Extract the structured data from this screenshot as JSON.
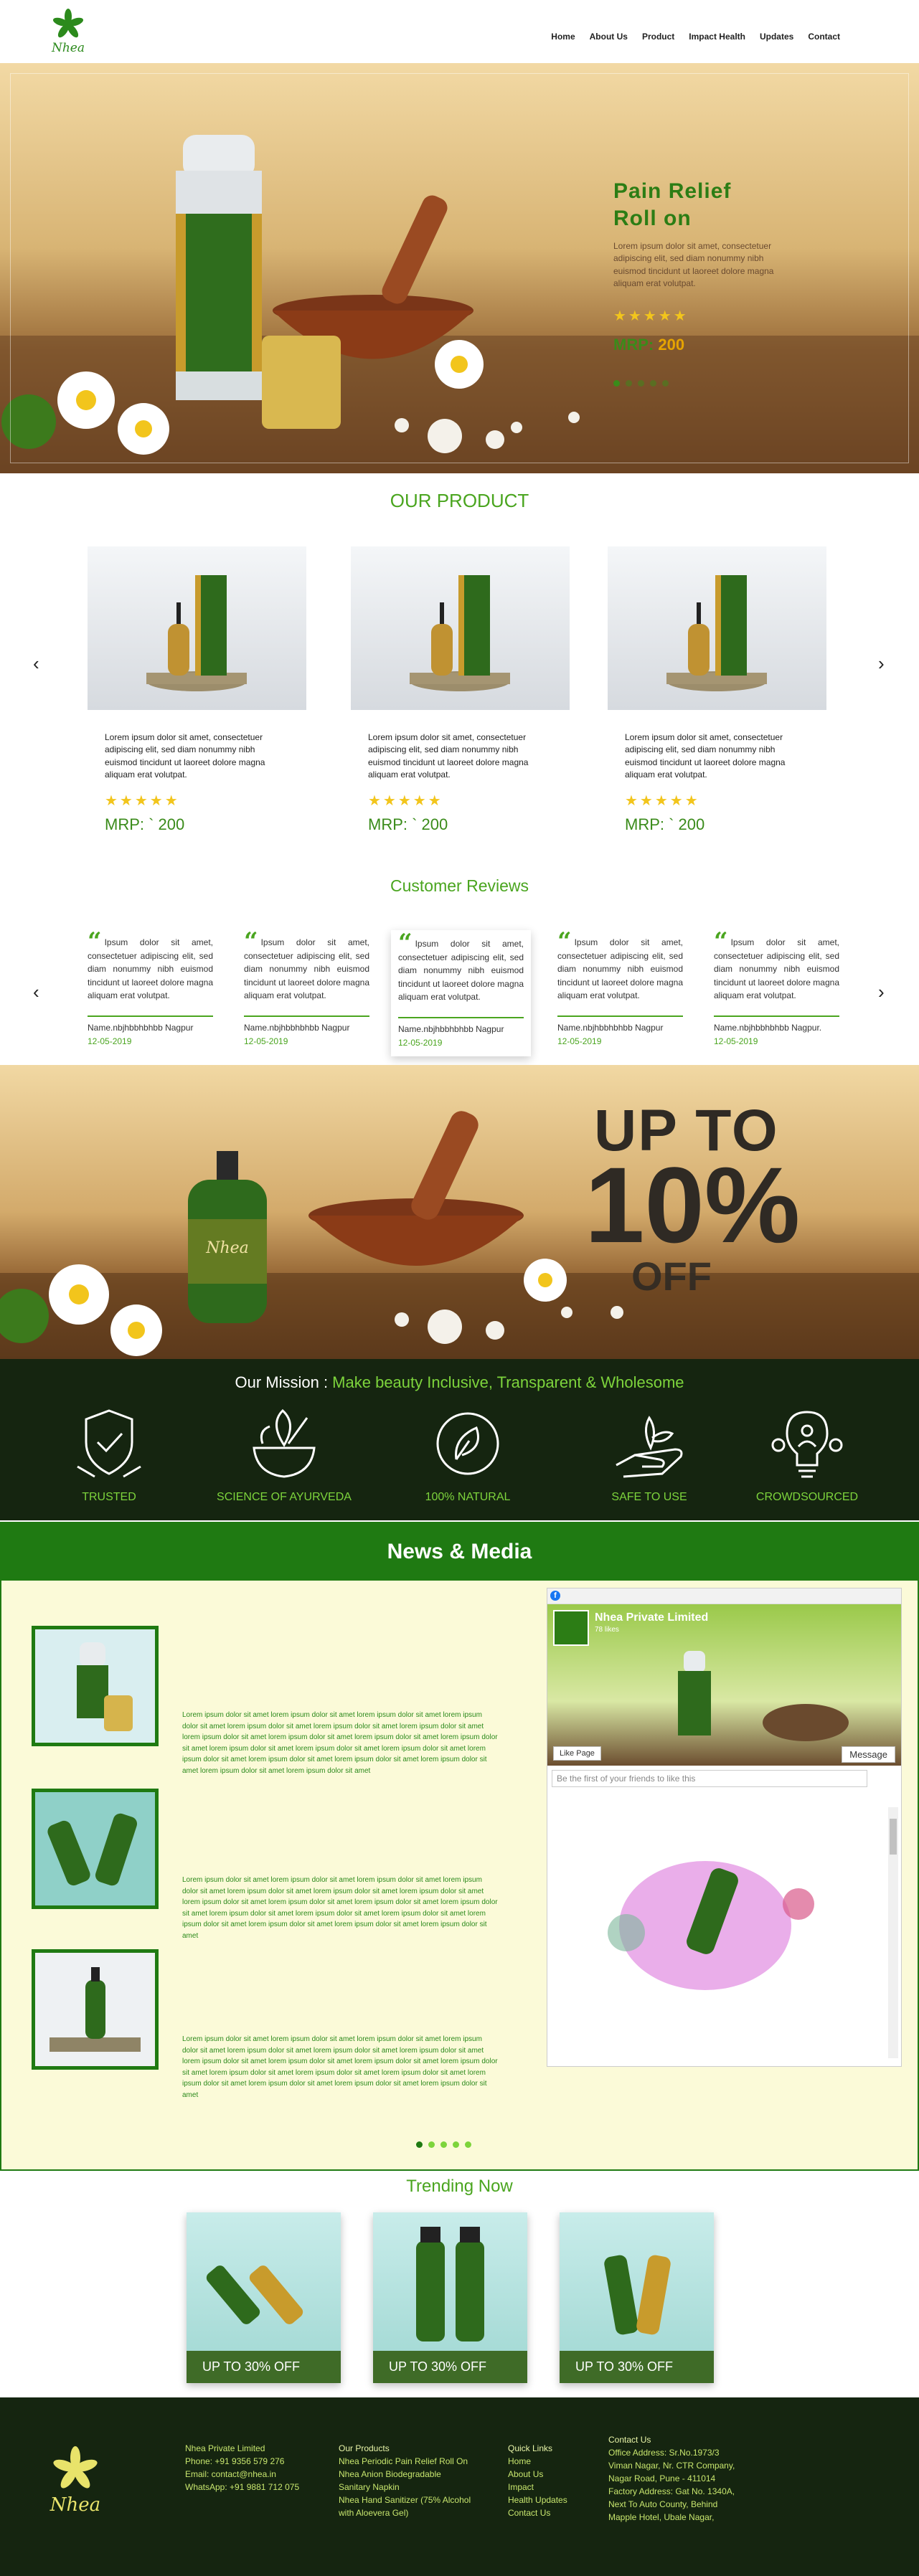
{
  "header": {
    "brand": "Nhea",
    "nav": [
      "Home",
      "About Us",
      "Product",
      "Impact Health",
      "Updates",
      "Contact"
    ]
  },
  "hero": {
    "title": "Pain Relief Roll on",
    "text": "Lorem ipsum dolor sit amet, consectetuer adipiscing elit, sed diam nonummy nibh euismod tincidunt ut laoreet dolore magna aliquam erat volutpat.",
    "stars": "★★★★★",
    "mrp_label": "MRP:",
    "mrp_value": "200"
  },
  "products": {
    "title": "OUR PRODUCT",
    "items": [
      {
        "text": "Lorem ipsum dolor sit amet, consectetuer adipiscing elit, sed diam nonummy nibh euismod tincidunt ut laoreet dolore magna aliquam erat volutpat.",
        "stars": "★★★★★",
        "mrp": "MRP:  ` 200"
      },
      {
        "text": "Lorem ipsum dolor sit amet, consectetuer adipiscing elit, sed diam nonummy nibh euismod tincidunt ut laoreet dolore magna aliquam erat volutpat.",
        "stars": "★★★★★",
        "mrp": "MRP:  ` 200"
      },
      {
        "text": "Lorem ipsum dolor sit amet, consectetuer adipiscing elit, sed diam nonummy nibh euismod tincidunt ut laoreet dolore magna aliquam erat volutpat.",
        "stars": "★★★★★",
        "mrp": "MRP:  ` 200"
      }
    ],
    "prev": "‹",
    "next": "›"
  },
  "reviews": {
    "title": "Customer Reviews",
    "items": [
      {
        "text": "Ipsum dolor sit amet, consectetuer adipiscing elit, sed diam nonummy nibh euismod tincidunt ut laoreet dolore magna aliquam erat volutpat.",
        "name": "Name.nbjhbbhbhbb Nagpur",
        "date": "12-05-2019"
      },
      {
        "text": "Ipsum dolor sit amet, consectetuer adipiscing elit, sed diam nonummy nibh euismod tincidunt ut laoreet dolore magna aliquam erat volutpat.",
        "name": "Name.nbjhbbhbhbb Nagpur",
        "date": "12-05-2019"
      },
      {
        "text": "Ipsum dolor sit amet, consectetuer adipiscing elit, sed diam nonummy nibh euismod tincidunt ut laoreet dolore magna aliquam erat volutpat.",
        "name": "Name.nbjhbbhbhbb Nagpur",
        "date": "12-05-2019"
      },
      {
        "text": "Ipsum dolor sit amet, consectetuer adipiscing elit, sed diam nonummy nibh euismod tincidunt ut laoreet dolore magna aliquam erat volutpat.",
        "name": "Name.nbjhbbhbhbb Nagpur",
        "date": "12-05-2019"
      },
      {
        "text": "Ipsum dolor sit amet, consectetuer adipiscing elit, sed diam nonummy nibh euismod tincidunt ut laoreet dolore magna aliquam erat volutpat.",
        "name": "Name.nbjhbbhbhbb Nagpur.",
        "date": "12-05-2019"
      }
    ],
    "prev": "‹",
    "next": "›"
  },
  "banner": {
    "line1": "UP TO",
    "line2": "10%",
    "line3": "OFF"
  },
  "mission": {
    "prefix": "Our Mission : ",
    "tagline": "Make beauty Inclusive, Transparent & Wholesome",
    "items": [
      {
        "label": "TRUSTED",
        "icon": "shield-handshake-icon"
      },
      {
        "label": "SCIENCE OF AYURVEDA",
        "icon": "mortar-leaf-icon"
      },
      {
        "label": "100% NATURAL",
        "icon": "leaf-circle-icon"
      },
      {
        "label": "SAFE TO USE",
        "icon": "hand-plant-icon"
      },
      {
        "label": "CROWDSOURCED",
        "icon": "lightbulb-people-icon"
      }
    ]
  },
  "news": {
    "title": "News & Media",
    "items": [
      {
        "text": "Lorem ipsum dolor sit amet lorem ipsum dolor sit amet lorem ipsum dolor sit amet lorem ipsum dolor sit amet lorem ipsum dolor sit amet lorem ipsum dolor sit amet lorem ipsum dolor sit amet lorem ipsum dolor sit amet lorem ipsum dolor sit amet lorem ipsum dolor sit amet lorem ipsum dolor sit amet lorem ipsum dolor sit amet lorem ipsum dolor sit amet lorem ipsum dolor sit amet lorem ipsum dolor sit amet lorem ipsum dolor sit amet lorem ipsum dolor sit amet lorem ipsum dolor sit amet lorem ipsum dolor sit amet lorem ipsum dolor sit amet"
      },
      {
        "text": "Lorem ipsum dolor sit amet lorem ipsum dolor sit amet lorem ipsum dolor sit amet lorem ipsum dolor sit amet lorem ipsum dolor sit amet lorem ipsum dolor sit amet lorem ipsum dolor sit amet lorem ipsum dolor sit amet lorem ipsum dolor sit amet lorem ipsum dolor sit amet lorem ipsum dolor sit amet lorem ipsum dolor sit amet lorem ipsum dolor sit amet lorem ipsum dolor sit amet lorem ipsum dolor sit amet lorem ipsum dolor sit amet lorem ipsum dolor sit amet lorem ipsum dolor sit amet"
      },
      {
        "text": "Lorem ipsum dolor sit amet lorem ipsum dolor sit amet lorem ipsum dolor sit amet lorem ipsum dolor sit amet lorem ipsum dolor sit amet lorem ipsum dolor sit amet lorem ipsum dolor sit amet lorem ipsum dolor sit amet lorem ipsum dolor sit amet lorem ipsum dolor sit amet lorem ipsum dolor sit amet lorem ipsum dolor sit amet lorem ipsum dolor sit amet lorem ipsum dolor sit amet lorem ipsum dolor sit amet lorem ipsum dolor sit amet lorem ipsum dolor sit amet lorem ipsum dolor sit amet"
      }
    ],
    "facebook": {
      "page_name": "Nhea Private Limited",
      "likes": "78 likes",
      "like_button": "Like Page",
      "message_button": "Message",
      "first_friend": "Be the first of your friends to like this"
    }
  },
  "trending": {
    "title": "Trending Now",
    "items": [
      {
        "label": "UP TO 30% OFF"
      },
      {
        "label": "UP TO 30% OFF"
      },
      {
        "label": "UP TO 30% OFF"
      }
    ]
  },
  "footer": {
    "brand": "Nhea",
    "company": [
      "Nhea Private Limited",
      "Phone: +91 9356 579 276",
      "Email: contact@nhea.in",
      "WhatsApp: +91 9881 712 075"
    ],
    "products_title": "Our Products",
    "products": [
      "Nhea Periodic Pain Relief Roll On",
      "Nhea Anion Biodegradable",
      "Sanitary Napkin",
      "Nhea Hand Sanitizer (75% Alcohol",
      "with Aloevera Gel)"
    ],
    "links_title": "Quick Links",
    "links": [
      "Home",
      "About Us",
      "Impact",
      "Health Updates",
      "Contact Us"
    ],
    "contact_title": "Contact Us",
    "contact": [
      "Office Address: Sr.No.1973/3",
      "Viman Nagar, Nr. CTR Company,",
      "Nagar Road, Pune - 411014",
      "Factory Address:   Gat No. 1340A,",
      "Next To Auto County, Behind",
      "Mapple Hotel, Ubale Nagar,"
    ]
  },
  "colors": {
    "brand_green": "#1f7a12",
    "accent_green": "#4aa51f",
    "dark_green": "#152510",
    "star": "#f2c51c"
  }
}
